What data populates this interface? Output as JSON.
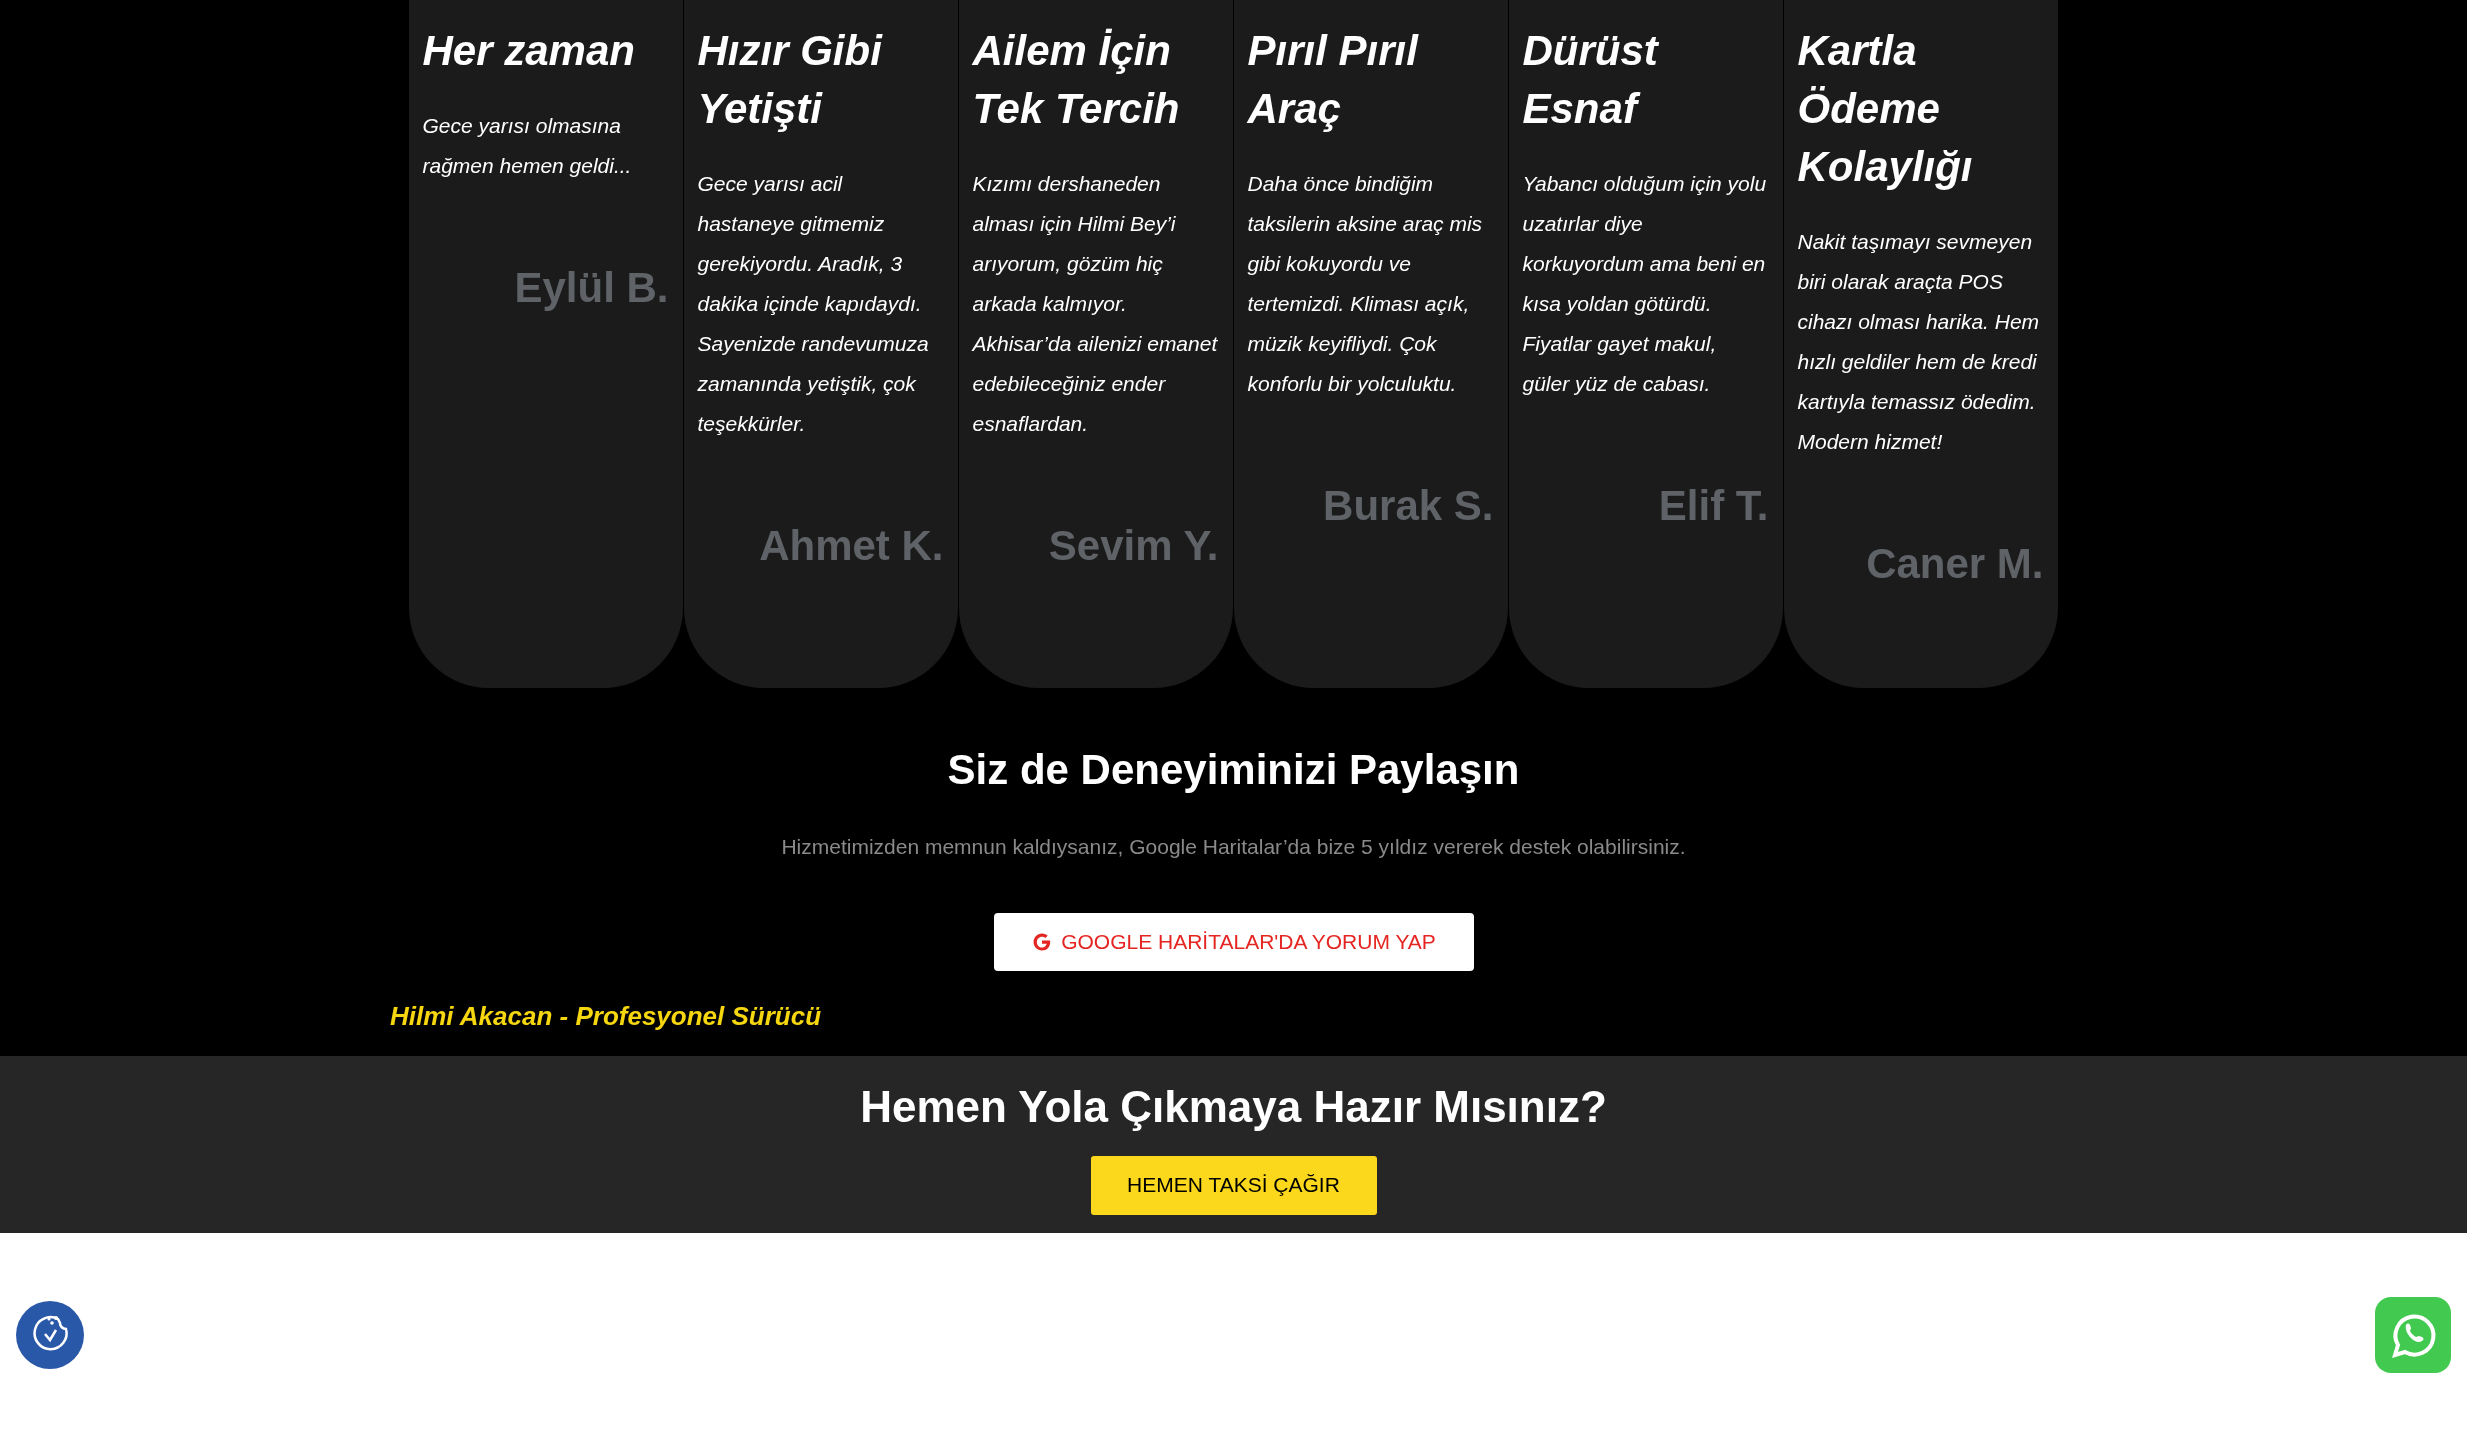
{
  "testimonials": [
    {
      "title": "Her zaman",
      "text": "Gece yarısı olmasına rağmen hemen geldi...",
      "author": "Eylül B."
    },
    {
      "title": "Hızır Gibi Yetişti",
      "text": "Gece yarısı acil hastaneye gitmemiz gerekiyordu. Aradık, 3 dakika içinde kapıdaydı. Sayenizde randevumuza zamanında yetiştik, çok teşekkürler.",
      "author": "Ahmet K."
    },
    {
      "title": "Ailem İçin Tek Tercih",
      "text": "Kızımı dershaneden alması için Hilmi Bey’i arıyorum, gözüm hiç arkada kalmıyor. Akhisar’da ailenizi emanet edebileceğiniz ender esnaflardan.",
      "author": "Sevim Y."
    },
    {
      "title": "Pırıl Pırıl Araç",
      "text": "Daha önce bindiğim taksilerin aksine araç mis gibi kokuyordu ve tertemizdi. Kliması açık, müzik keyifliydi. Çok konforlu bir yolculuktu.",
      "author": "Burak S."
    },
    {
      "title": "Dürüst Esnaf",
      "text": "Yabancı olduğum için yolu uzatırlar diye korkuyordum ama beni en kısa yoldan götürdü. Fiyatlar gayet makul, güler yüz de cabası.",
      "author": "Elif T."
    },
    {
      "title": "Kartla Ödeme Kolaylığı",
      "text": "Nakit taşımayı sevmeyen biri olarak araçta POS cihazı olması harika. Hem hızlı geldiler hem de kredi kartıyla temassız ödedim. Modern hizmet!",
      "author": "Caner M."
    }
  ],
  "review": {
    "heading": "Siz de Deneyiminizi Paylaşın",
    "text": "Hizmetimizden memnun kaldıysanız, Google Haritalar’da bize 5 yıldız vererek destek olabilirsiniz.",
    "button": "GOOGLE HARİTALAR'DA YORUM YAP",
    "signature": "Hilmi Akacan - Profesyonel Sürücü"
  },
  "cta": {
    "heading": "Hemen Yola Çıkmaya Hazır Mısınız?",
    "button": "HEMEN TAKSİ ÇAĞIR"
  }
}
